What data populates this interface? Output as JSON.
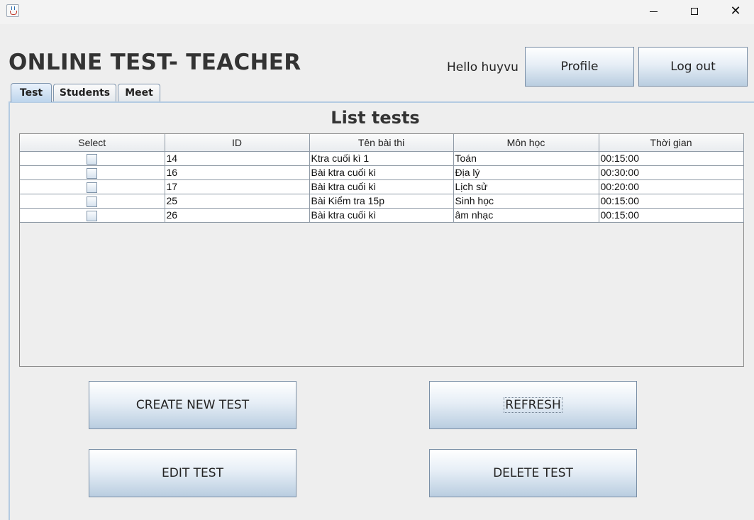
{
  "window": {
    "title_icon": "java-cup-icon",
    "minimize_icon": "minimize-icon",
    "maximize_icon": "maximize-icon",
    "close_icon": "close-icon",
    "close_glyph": "✕"
  },
  "header": {
    "title": "ONLINE TEST- TEACHER",
    "greeting": "Hello huyvu",
    "profile_label": "Profile",
    "logout_label": "Log out"
  },
  "tabs": [
    {
      "label": "Test",
      "selected": true
    },
    {
      "label": "Students",
      "selected": false
    },
    {
      "label": "Meet",
      "selected": false
    }
  ],
  "list": {
    "title": "List tests",
    "columns": [
      "Select",
      "ID",
      "Tên bài thi",
      "Môn học",
      "Thời gian"
    ],
    "rows": [
      {
        "selected": false,
        "id": "14",
        "name": "Ktra cuối kì 1",
        "subject": "Toán",
        "duration": "00:15:00"
      },
      {
        "selected": false,
        "id": "16",
        "name": "Bài ktra cuối kì",
        "subject": "Địa lý",
        "duration": "00:30:00"
      },
      {
        "selected": false,
        "id": "17",
        "name": "Bài ktra cuối kì",
        "subject": "Lịch sử",
        "duration": "00:20:00"
      },
      {
        "selected": false,
        "id": "25",
        "name": "Bài Kiểm tra 15p",
        "subject": "Sinh học",
        "duration": "00:15:00"
      },
      {
        "selected": false,
        "id": "26",
        "name": "Bài ktra cuối kì",
        "subject": "âm nhạc",
        "duration": "00:15:00"
      }
    ]
  },
  "actions": {
    "create_label": "CREATE NEW TEST",
    "refresh_label": "REFRESH",
    "edit_label": "EDIT TEST",
    "delete_label": "DELETE TEST"
  },
  "colors": {
    "background": "#eeeeee",
    "button_gradient_top": "#ffffff",
    "button_gradient_bottom": "#b9cde0",
    "tab_border": "#b4cbe2"
  }
}
